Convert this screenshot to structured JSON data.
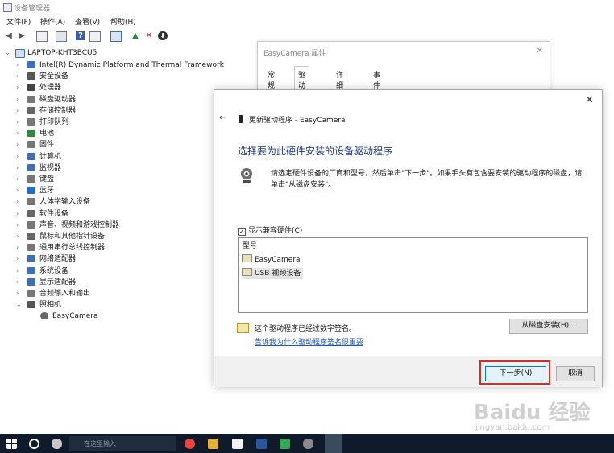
{
  "window": {
    "title": "设备管理器"
  },
  "menu": [
    "文件(F)",
    "操作(A)",
    "查看(V)",
    "帮助(H)"
  ],
  "tree": {
    "root": "LAPTOP-KHT3BCU5",
    "items": [
      "Intel(R) Dynamic Platform and Thermal Framework",
      "安全设备",
      "处理器",
      "磁盘驱动器",
      "存储控制器",
      "打印队列",
      "电池",
      "固件",
      "计算机",
      "监视器",
      "键盘",
      "蓝牙",
      "人体学输入设备",
      "软件设备",
      "声音、视频和游戏控制器",
      "鼠标和其他指针设备",
      "通用串行总线控制器",
      "网络适配器",
      "系统设备",
      "显示适配器",
      "音频输入和输出",
      "照相机"
    ],
    "child": "EasyCamera"
  },
  "props_dialog": {
    "title": "EasyCamera 属性",
    "tabs": [
      "常规",
      "驱动程序",
      "详细信息",
      "事件"
    ]
  },
  "update_dialog": {
    "header": "更新驱动程序 - EasyCamera",
    "heading": "选择要为此硬件安装的设备驱动程序",
    "description": "请选定硬件设备的厂商和型号，然后单击\"下一步\"。如果手头有包含要安装的驱动程序的磁盘，请单击\"从磁盘安装\"。",
    "show_compatible": "显示兼容硬件(C)",
    "list_header": "型号",
    "models": [
      "EasyCamera",
      "USB 视频设备"
    ],
    "signed_text": "这个驱动程序已经过数字签名。",
    "why_link": "告诉我为什么驱动程序签名很重要",
    "have_disk_button": "从磁盘安装(H)...",
    "next_button": "下一步(N)",
    "cancel_button": "取消"
  },
  "watermark": {
    "text": "Baidu 经验",
    "url": "jingyan.baidu.com"
  },
  "taskbar": {
    "search_placeholder": "在这里输入"
  },
  "colors": {
    "heading": "#1e3a8a",
    "link": "#1f56c9",
    "highlight": "#d0302a",
    "taskbar": "#0f1b2a"
  }
}
